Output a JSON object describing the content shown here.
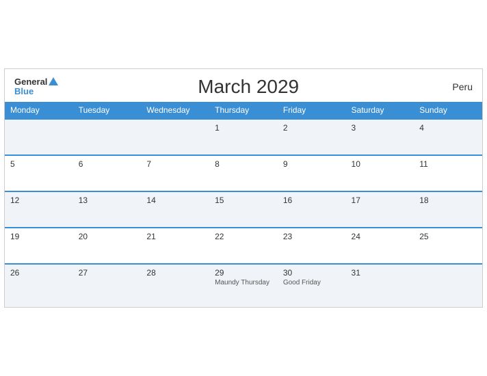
{
  "header": {
    "logo_general": "General",
    "logo_blue": "Blue",
    "title": "March 2029",
    "country": "Peru"
  },
  "days_of_week": [
    "Monday",
    "Tuesday",
    "Wednesday",
    "Thursday",
    "Friday",
    "Saturday",
    "Sunday"
  ],
  "weeks": [
    [
      {
        "day": "",
        "holiday": ""
      },
      {
        "day": "",
        "holiday": ""
      },
      {
        "day": "",
        "holiday": ""
      },
      {
        "day": "1",
        "holiday": ""
      },
      {
        "day": "2",
        "holiday": ""
      },
      {
        "day": "3",
        "holiday": ""
      },
      {
        "day": "4",
        "holiday": ""
      }
    ],
    [
      {
        "day": "5",
        "holiday": ""
      },
      {
        "day": "6",
        "holiday": ""
      },
      {
        "day": "7",
        "holiday": ""
      },
      {
        "day": "8",
        "holiday": ""
      },
      {
        "day": "9",
        "holiday": ""
      },
      {
        "day": "10",
        "holiday": ""
      },
      {
        "day": "11",
        "holiday": ""
      }
    ],
    [
      {
        "day": "12",
        "holiday": ""
      },
      {
        "day": "13",
        "holiday": ""
      },
      {
        "day": "14",
        "holiday": ""
      },
      {
        "day": "15",
        "holiday": ""
      },
      {
        "day": "16",
        "holiday": ""
      },
      {
        "day": "17",
        "holiday": ""
      },
      {
        "day": "18",
        "holiday": ""
      }
    ],
    [
      {
        "day": "19",
        "holiday": ""
      },
      {
        "day": "20",
        "holiday": ""
      },
      {
        "day": "21",
        "holiday": ""
      },
      {
        "day": "22",
        "holiday": ""
      },
      {
        "day": "23",
        "holiday": ""
      },
      {
        "day": "24",
        "holiday": ""
      },
      {
        "day": "25",
        "holiday": ""
      }
    ],
    [
      {
        "day": "26",
        "holiday": ""
      },
      {
        "day": "27",
        "holiday": ""
      },
      {
        "day": "28",
        "holiday": ""
      },
      {
        "day": "29",
        "holiday": "Maundy Thursday"
      },
      {
        "day": "30",
        "holiday": "Good Friday"
      },
      {
        "day": "31",
        "holiday": ""
      },
      {
        "day": "",
        "holiday": ""
      }
    ]
  ]
}
